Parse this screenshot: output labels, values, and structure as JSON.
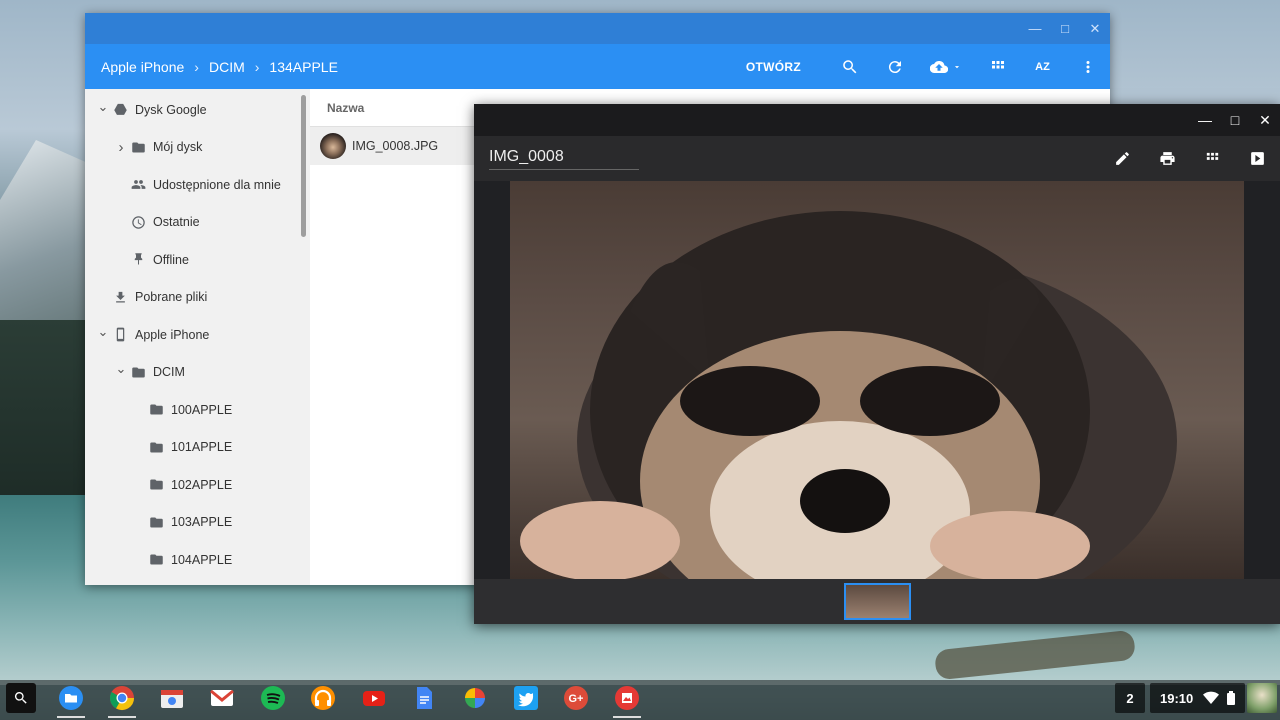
{
  "file_manager": {
    "breadcrumb": [
      "Apple iPhone",
      "DCIM",
      "134APPLE"
    ],
    "open_label": "OTWÓRZ",
    "sort_label": "AZ",
    "column_name": "Nazwa",
    "sidebar": [
      {
        "label": "Dysk Google",
        "icon": "drive-icon",
        "chevron": "down"
      },
      {
        "label": "Mój dysk",
        "icon": "my-drive-folder-icon",
        "chevron": "right"
      },
      {
        "label": "Udostępnione dla mnie",
        "icon": "shared-people-icon",
        "chevron": ""
      },
      {
        "label": "Ostatnie",
        "icon": "clock-icon",
        "chevron": ""
      },
      {
        "label": "Offline",
        "icon": "pin-icon",
        "chevron": ""
      },
      {
        "label": "Pobrane pliki",
        "icon": "download-icon",
        "chevron": ""
      },
      {
        "label": "Apple iPhone",
        "icon": "phone-icon",
        "chevron": "down"
      },
      {
        "label": "DCIM",
        "icon": "folder-icon",
        "chevron": "down"
      },
      {
        "label": "100APPLE",
        "icon": "folder-icon",
        "chevron": ""
      },
      {
        "label": "101APPLE",
        "icon": "folder-icon",
        "chevron": ""
      },
      {
        "label": "102APPLE",
        "icon": "folder-icon",
        "chevron": ""
      },
      {
        "label": "103APPLE",
        "icon": "folder-icon",
        "chevron": ""
      },
      {
        "label": "104APPLE",
        "icon": "folder-icon",
        "chevron": ""
      }
    ],
    "files": [
      {
        "name": "IMG_0008.JPG"
      }
    ]
  },
  "gallery": {
    "title": "IMG_0008"
  },
  "shelf": {
    "notification_count": "2",
    "clock": "19:10"
  },
  "colors": {
    "accent": "#2b8ff3",
    "titlebar": "#2f7fd6",
    "gallery_bg": "#202124"
  }
}
